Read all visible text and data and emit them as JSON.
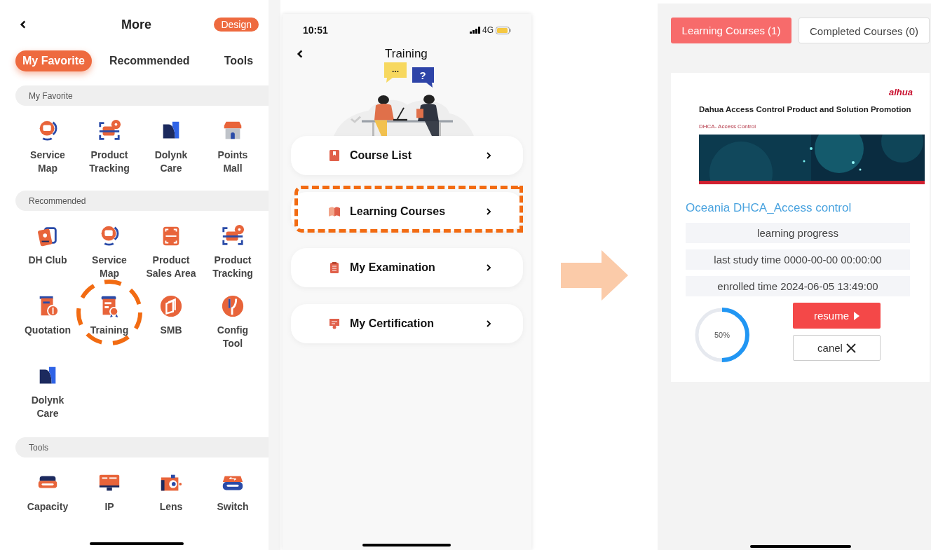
{
  "favorites_screen": {
    "title": "More",
    "badge": "Design",
    "tabs": [
      {
        "label": "My Favorite",
        "selected": true
      },
      {
        "label": "Recommended",
        "selected": false
      },
      {
        "label": "Tools",
        "selected": false
      }
    ],
    "sections": [
      {
        "title": "My Favorite",
        "items": [
          {
            "label": "Service\nMap",
            "highlighted": false
          },
          {
            "label": "Product\nTracking",
            "highlighted": false
          },
          {
            "label": "Dolynk\nCare",
            "highlighted": false
          },
          {
            "label": "Points\nMall",
            "highlighted": false
          }
        ]
      },
      {
        "title": "Recommended",
        "items": [
          {
            "label": "DH Club",
            "highlighted": false
          },
          {
            "label": "Service\nMap",
            "highlighted": false
          },
          {
            "label": "Product\nSales Area",
            "highlighted": false
          },
          {
            "label": "Product\nTracking",
            "highlighted": false
          },
          {
            "label": "Quotation",
            "highlighted": false
          },
          {
            "label": "Training",
            "highlighted": true
          },
          {
            "label": "SMB",
            "highlighted": false
          },
          {
            "label": "Config\nTool",
            "highlighted": false
          },
          {
            "label": "Dolynk\nCare",
            "highlighted": false
          }
        ]
      },
      {
        "title": "Tools",
        "items": [
          {
            "label": "Capacity",
            "highlighted": false
          },
          {
            "label": "IP",
            "highlighted": false
          },
          {
            "label": "Lens",
            "highlighted": false
          },
          {
            "label": "Switch",
            "highlighted": false
          }
        ]
      }
    ]
  },
  "training_screen": {
    "time": "10:51",
    "network": "4G",
    "title": "Training",
    "bubbles": [
      "...",
      "?"
    ],
    "menu": [
      {
        "label": "Course List",
        "highlighted": false
      },
      {
        "label": "Learning Courses",
        "highlighted": true
      },
      {
        "label": "My Examination",
        "highlighted": false
      },
      {
        "label": "My Certification",
        "highlighted": false
      }
    ]
  },
  "courses_screen": {
    "tabs": [
      {
        "label": "Learning Courses (1)",
        "selected": true
      },
      {
        "label": "Completed Courses (0)",
        "selected": false
      }
    ],
    "course": {
      "logo": "alhua",
      "slide_title": "Dahua Access Control Product and Solution Promotion",
      "slide_subtitle": "DHCA- Access Control",
      "name": "Oceania DHCA_Access control",
      "details": [
        "learning progress",
        "last study time 0000-00-00 00:00:00",
        "enrolled time 2024-06-05 13:49:00"
      ],
      "progress": "50%",
      "level": 0.5,
      "buttons": [
        {
          "label": "resume",
          "kind": "primary"
        },
        {
          "label": "canel",
          "kind": "secondary"
        }
      ]
    }
  }
}
